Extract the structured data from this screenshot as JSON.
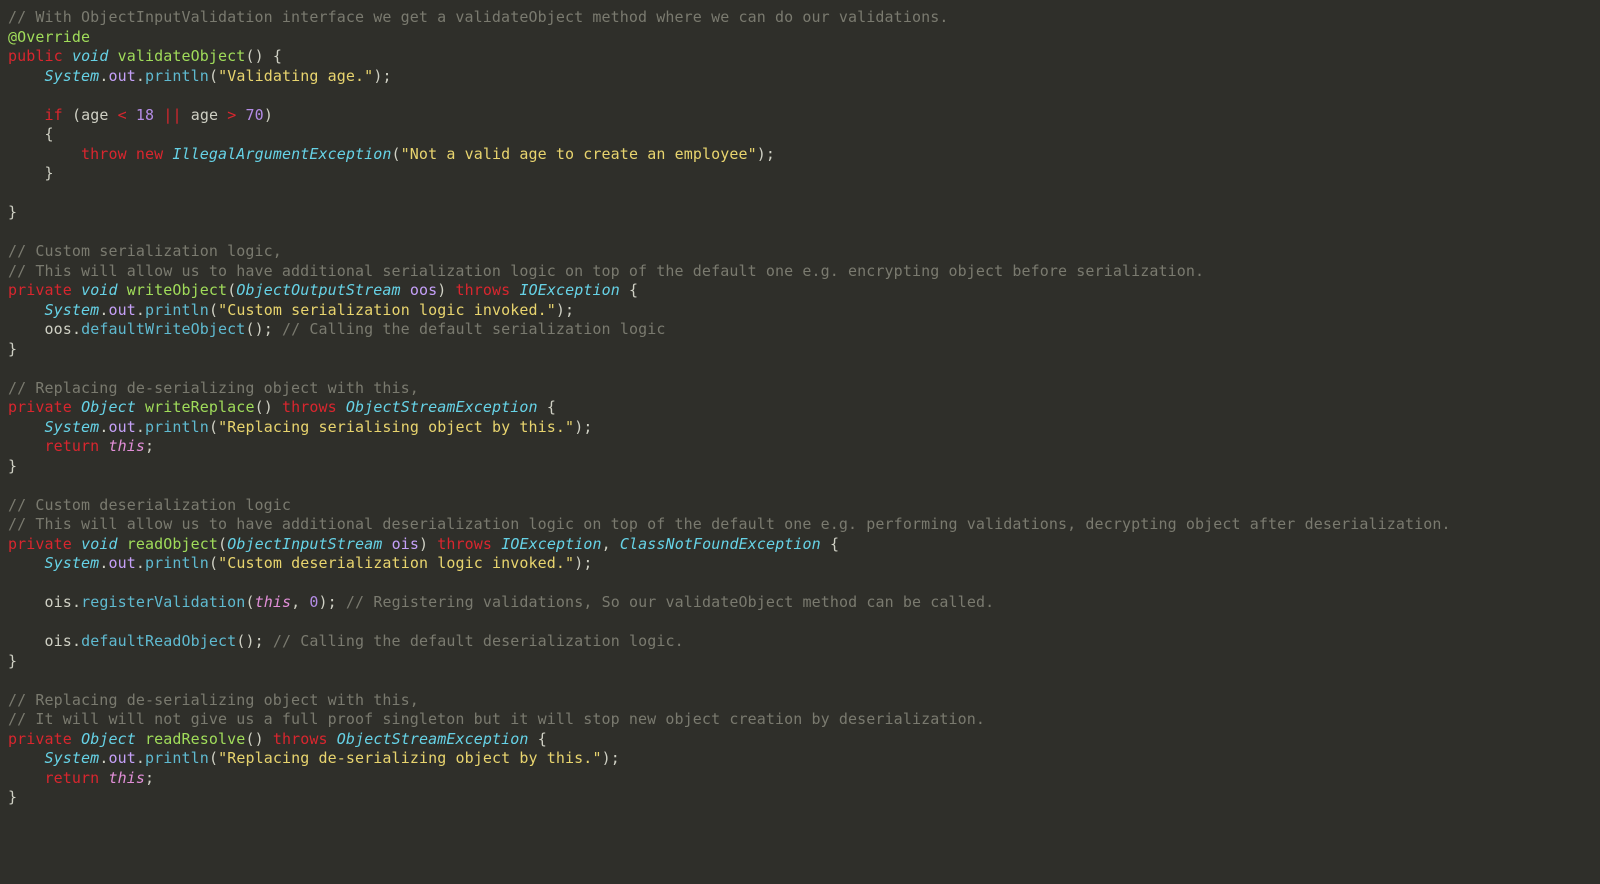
{
  "code": {
    "comments": {
      "c1": "// With ObjectInputValidation interface we get a validateObject method where we can do our validations.",
      "c2a": "// Custom serialization logic,",
      "c2b": "// This will allow us to have additional serialization logic on top of the default one e.g. encrypting object before serialization.",
      "c2c": "// Calling the default serialization logic",
      "c3a": "// Replacing de-serializing object with this,",
      "c4a": "// Custom deserialization logic",
      "c4b": "// This will allow us to have additional deserialization logic on top of the default one e.g. performing validations, decrypting object after deserialization.",
      "c4c": "// Registering validations, So our validateObject method can be called.",
      "c4d": "// Calling the default deserialization logic.",
      "c5a": "// Replacing de-serializing object with this,",
      "c5b": "// It will will not give us a full proof singleton but it will stop new object creation by deserialization."
    },
    "anno_override": "@Override",
    "kw": {
      "public": "public",
      "private": "private",
      "void": "void",
      "if": "if",
      "throw": "throw",
      "new": "new",
      "throws": "throws",
      "return": "return",
      "this": "this"
    },
    "types": {
      "Object": "Object",
      "ObjectOutputStream": "ObjectOutputStream",
      "ObjectInputStream": "ObjectInputStream",
      "IOException": "IOException",
      "ClassNotFoundException": "ClassNotFoundException",
      "ObjectStreamException": "ObjectStreamException",
      "IllegalArgumentException": "IllegalArgumentException",
      "System": "System"
    },
    "ids": {
      "validateObject": "validateObject",
      "writeObject": "writeObject",
      "writeReplace": "writeReplace",
      "readObject": "readObject",
      "readResolve": "readResolve",
      "println": "println",
      "defaultWriteObject": "defaultWriteObject",
      "defaultReadObject": "defaultReadObject",
      "registerValidation": "registerValidation",
      "out": "out",
      "age": "age",
      "oos": "oos",
      "ois": "ois"
    },
    "strings": {
      "s1": "\"Validating age.\"",
      "s2": "\"Not a valid age to create an employee\"",
      "s3": "\"Custom serialization logic invoked.\"",
      "s4": "\"Replacing serialising object by this.\"",
      "s5": "\"Custom deserialization logic invoked.\"",
      "s6": "\"Replacing de-serializing object by this.\""
    },
    "numbers": {
      "n18": "18",
      "n70": "70",
      "n0": "0"
    },
    "ops": {
      "lt": "<",
      "gt": ">",
      "oror": "||"
    }
  }
}
